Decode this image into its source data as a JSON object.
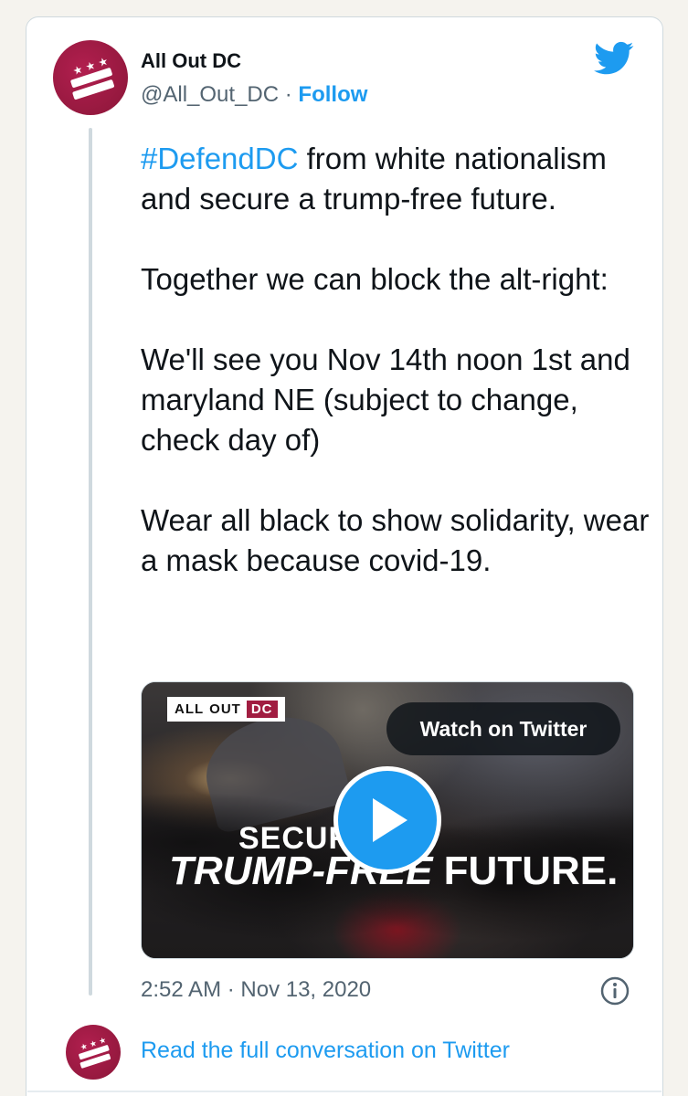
{
  "account": {
    "name": "All Out DC",
    "handle": "@All_Out_DC",
    "separator": "·",
    "follow_label": "Follow"
  },
  "tweet": {
    "hashtag": "#DefendDC",
    "paragraphs": [
      " from white nationalism and secure a trump-free future.",
      "Together we can block the alt-right:",
      "We'll see you Nov 14th noon 1st and maryland NE (subject to change, check day of)",
      "Wear all black to show solidarity, wear a mask because covid-19."
    ],
    "timestamp": "2:52 AM · Nov 13, 2020"
  },
  "media": {
    "brand_all": "ALL",
    "brand_out": "OUT",
    "brand_dc": "DC",
    "overlay_line1": "SECURE",
    "overlay_line2_italic": "TRUMP-FREE",
    "overlay_line2_rest": " FUTURE.",
    "watch_label": "Watch on Twitter"
  },
  "footer": {
    "read_full_label": "Read the full conversation on Twitter"
  },
  "colors": {
    "accent": "#1d9bf0",
    "brand": "#a11d41"
  },
  "icons": {
    "bird": "twitter-bird-icon",
    "info": "info-icon",
    "play": "play-icon"
  }
}
